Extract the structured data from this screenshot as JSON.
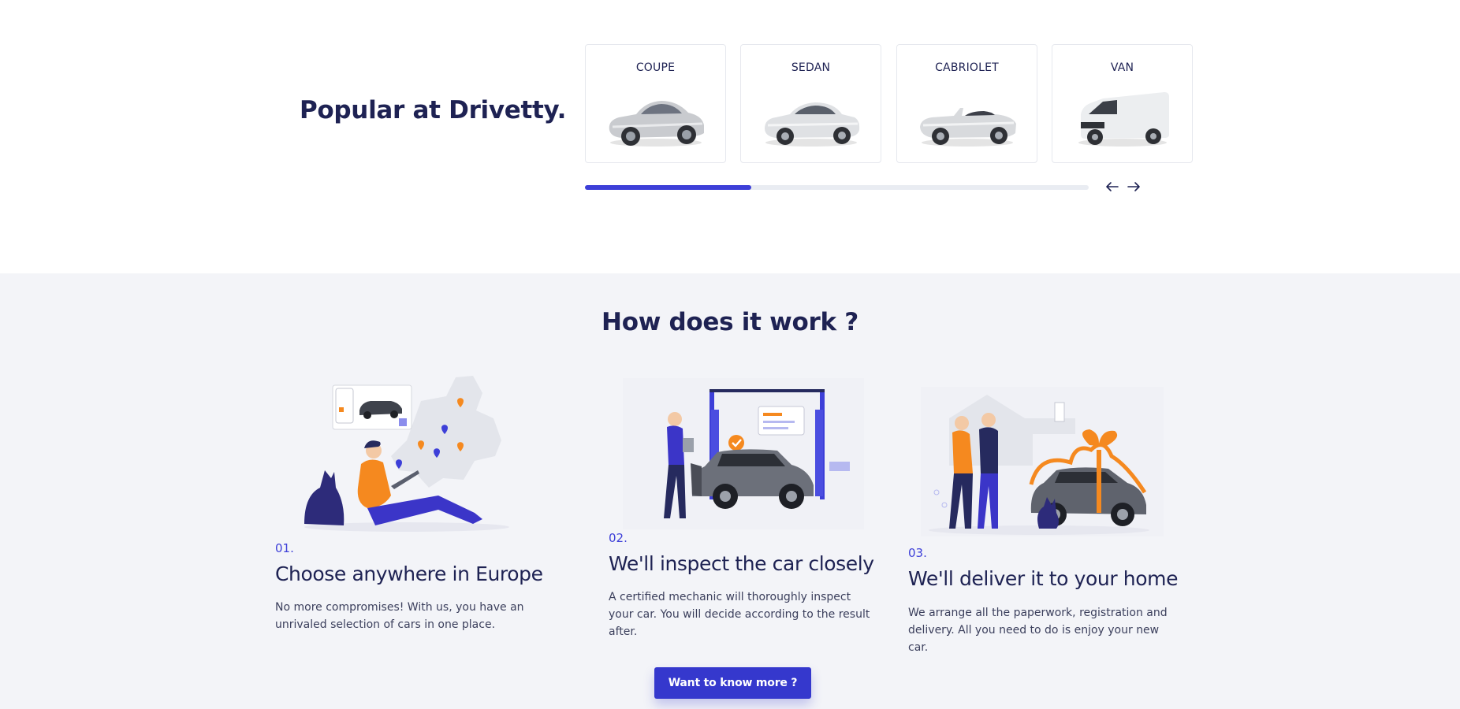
{
  "popular": {
    "title": "Popular at Drivetty.",
    "cards": [
      {
        "label": "COUPE",
        "icon": "coupe-car-image"
      },
      {
        "label": "SEDAN",
        "icon": "sedan-car-image"
      },
      {
        "label": "CABRIOLET",
        "icon": "cabriolet-car-image"
      },
      {
        "label": "VAN",
        "icon": "van-image"
      }
    ],
    "progress": 0.33,
    "prev_icon": "arrow-left-icon",
    "next_icon": "arrow-right-icon"
  },
  "how": {
    "title": "How does it work ?",
    "steps": [
      {
        "num": "01.",
        "title": "Choose anywhere in Europe",
        "text": "No more compromises! With us, you have an unrivaled selection of cars in one place."
      },
      {
        "num": "02.",
        "title": "We'll inspect the car closely",
        "text": "A certified mechanic will thoroughly inspect your car. You will decide according to the result after."
      },
      {
        "num": "03.",
        "title": "We'll deliver it to your home",
        "text": "We arrange all the paperwork, registration and delivery. All you need to do is enjoy your new car."
      }
    ],
    "cta": "Want to know more ?"
  },
  "colors": {
    "accent": "#3d3fd8",
    "navy": "#1e2253",
    "orange": "#f5891f",
    "section_bg": "#f3f4f8"
  }
}
